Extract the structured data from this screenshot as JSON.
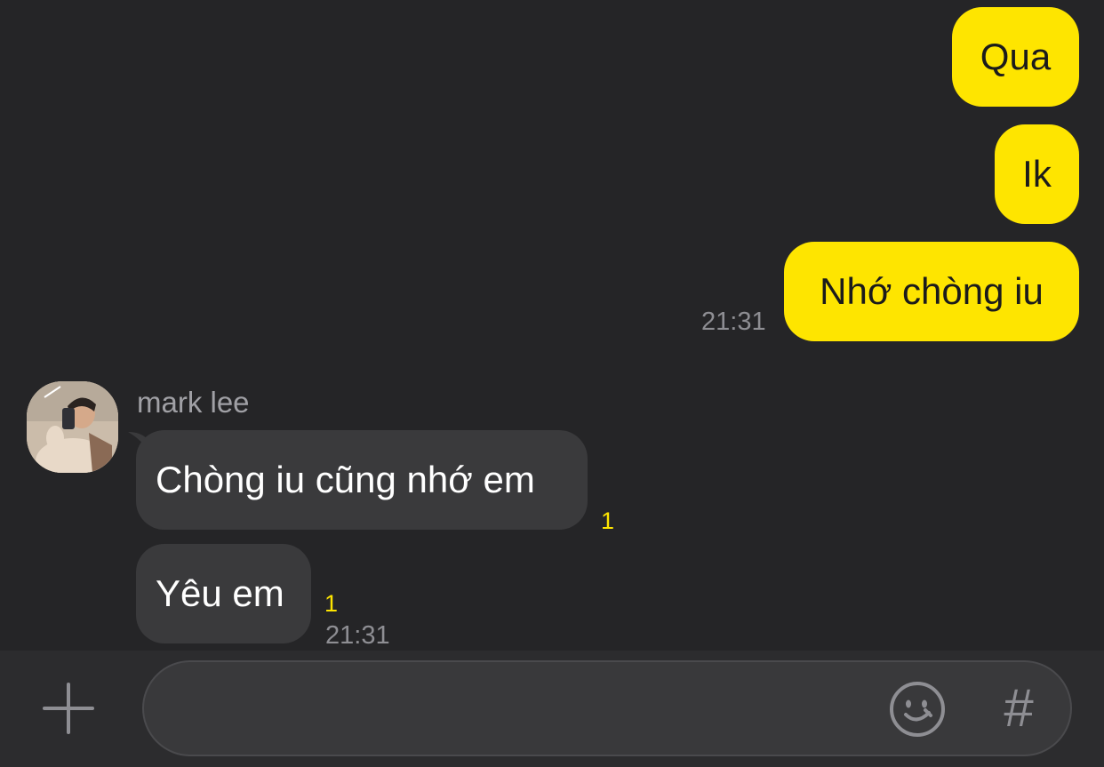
{
  "messages_out": [
    {
      "text": "Qua"
    },
    {
      "text": "Ik"
    },
    {
      "text": "Nhớ chòng iu",
      "time": "21:31"
    }
  ],
  "contact": {
    "name": "mark lee"
  },
  "messages_in": [
    {
      "text": "Chòng iu cũng nhớ em",
      "unread": "1"
    },
    {
      "text": "Yêu em",
      "unread": "1",
      "time": "21:31"
    }
  ],
  "input_bar": {
    "placeholder": "",
    "hash_symbol": "#",
    "icons": [
      "plus-icon",
      "emoji-icon",
      "hashtag-icon"
    ]
  },
  "colors": {
    "background": "#252527",
    "outgoing_bubble": "#FEE500",
    "incoming_bubble": "#3A3A3C",
    "unread_count": "#FEE500",
    "timestamp": "#8e8e93"
  }
}
